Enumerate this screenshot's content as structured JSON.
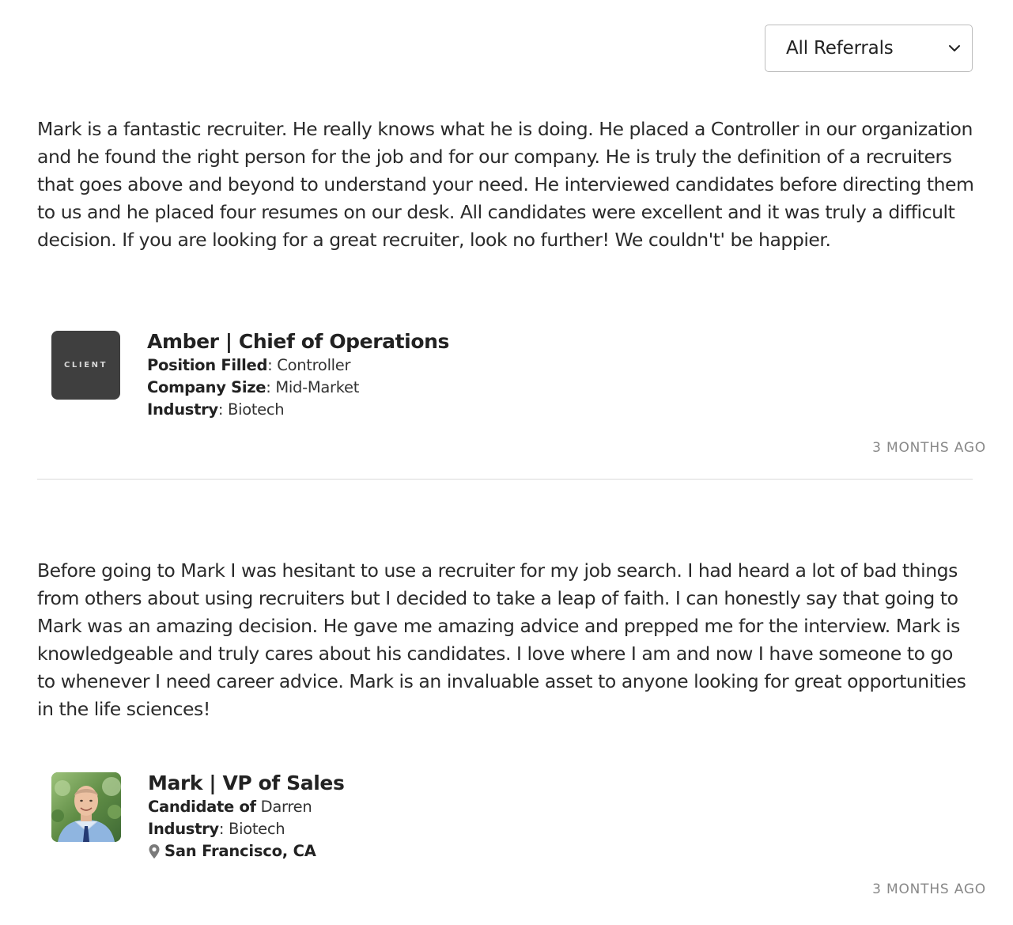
{
  "filter": {
    "selected": "All Referrals",
    "icon": "chevron-down-icon"
  },
  "reviews": [
    {
      "text": "Mark is a fantastic recruiter. He really knows what he is doing. He placed a Controller in our organization and he found the right person for the job and for our company. He is truly the definition of a recruiters that goes above and beyond to understand your need. He interviewed candidates before directing them to us and he placed four resumes on our desk. All candidates were excellent and it was truly a difficult decision. If you are looking for a great recruiter, look no further! We couldn't' be happier.",
      "logo_text": "CLIENT",
      "author": "Amber | Chief of Operations",
      "meta": [
        {
          "label": "Position Filled",
          "sep": ": ",
          "value": "Controller"
        },
        {
          "label": "Company Size",
          "sep": ": ",
          "value": "Mid-Market"
        },
        {
          "label": "Industry",
          "sep": ": ",
          "value": "Biotech"
        }
      ],
      "time_ago": "3 MONTHS AGO"
    },
    {
      "text": "Before going to Mark I was hesitant to use a recruiter for my job search. I had heard a lot of bad things from others about using recruiters but I decided to take a leap of faith. I can honestly say that going to Mark was an amazing decision. He gave me amazing advice and prepped me for the interview. Mark is knowledgeable and truly cares about his candidates. I love where I am and now I have someone to go to whenever I need career advice. Mark is an invaluable asset to anyone looking for great opportunities in the life sciences!",
      "author": "Mark | VP of Sales",
      "meta": [
        {
          "label": "Candidate of",
          "sep": " ",
          "value": "Darren"
        },
        {
          "label": "Industry",
          "sep": ": ",
          "value": "Biotech"
        }
      ],
      "location": "San Francisco, CA",
      "location_icon": "map-pin-icon",
      "time_ago": "3 MONTHS AGO"
    }
  ]
}
